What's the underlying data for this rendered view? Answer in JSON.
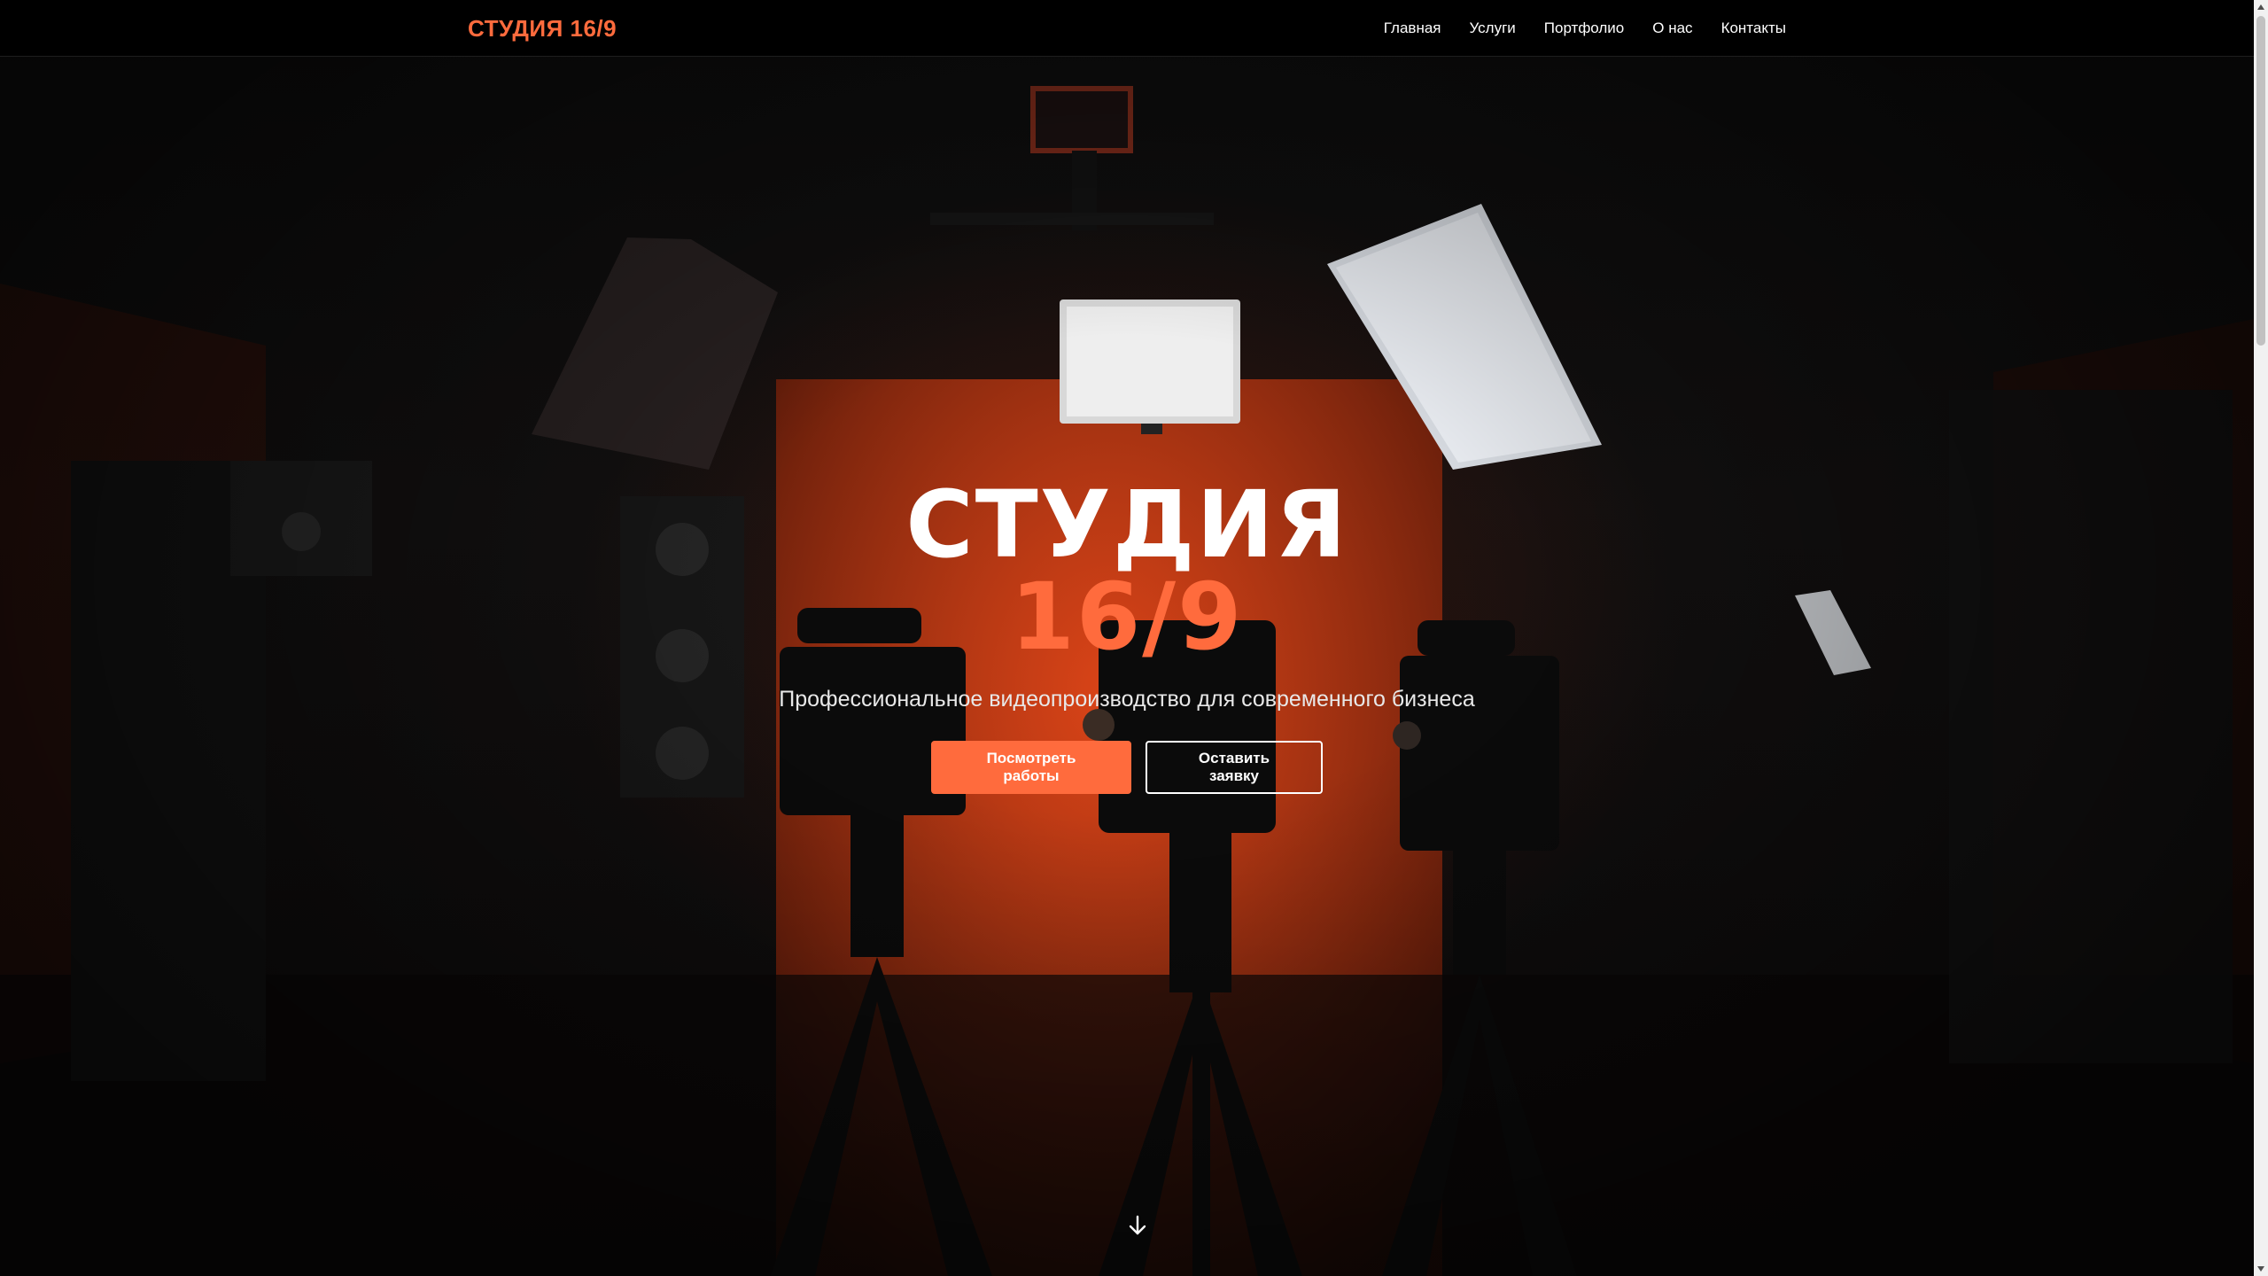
{
  "header": {
    "logo": "СТУДИЯ 16/9",
    "nav": [
      {
        "label": "Главная"
      },
      {
        "label": "Услуги"
      },
      {
        "label": "Портфолио"
      },
      {
        "label": "О нас"
      },
      {
        "label": "Контакты"
      }
    ]
  },
  "hero": {
    "title_line1": "СТУДИЯ",
    "title_line2": "16/9",
    "subtitle": "Профессиональное видеопроизводство для современного бизнеса",
    "primary_button": "Посмотреть работы",
    "secondary_button": "Оставить заявку",
    "scroll_icon": "arrow-down-icon"
  },
  "colors": {
    "accent": "#ff6b3d",
    "header_bg": "#000000",
    "text": "#ffffff"
  }
}
